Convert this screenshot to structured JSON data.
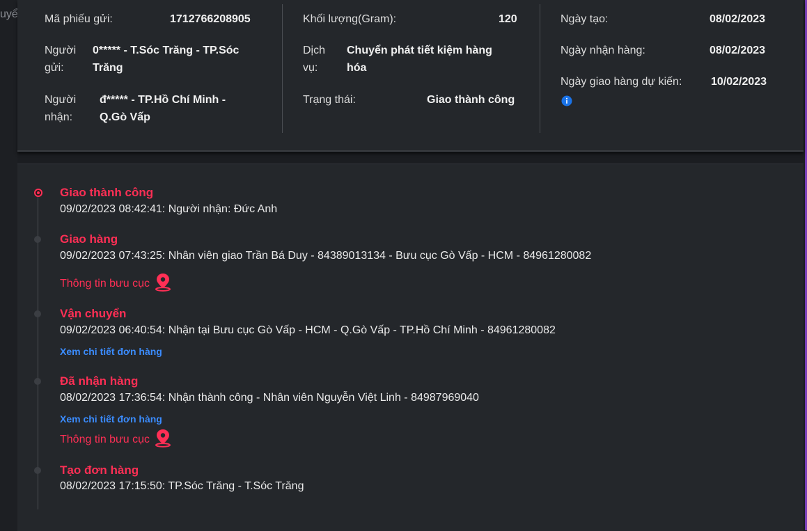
{
  "background": {
    "partial_text": "uyển dụng"
  },
  "info": {
    "col1": {
      "ma_phieu_label": "Mã phiếu gửi:",
      "ma_phieu_value": "1712766208905",
      "nguoi_gui_label_1": "Người",
      "nguoi_gui_label_2": "gửi:",
      "nguoi_gui_value_1": "0***** - T.Sóc Trăng - TP.Sóc",
      "nguoi_gui_value_2": "Trăng",
      "nguoi_nhan_label_1": "Người",
      "nguoi_nhan_label_2": "nhận:",
      "nguoi_nhan_value_1": "đ***** - TP.Hồ Chí Minh -",
      "nguoi_nhan_value_2": "Q.Gò Vấp"
    },
    "col2": {
      "khoi_luong_label": "Khối lượng(Gram):",
      "khoi_luong_value": "120",
      "dich_vu_label_1": "Dịch",
      "dich_vu_label_2": "vụ:",
      "dich_vu_value_1": "Chuyển phát tiết kiệm hàng",
      "dich_vu_value_2": "hóa",
      "trang_thai_label": "Trạng thái:",
      "trang_thai_value": "Giao thành công"
    },
    "col3": {
      "ngay_tao_label": "Ngày tạo:",
      "ngay_tao_value": "08/02/2023",
      "ngay_nhan_label": "Ngày nhận hàng:",
      "ngay_nhan_value": "08/02/2023",
      "ngay_giao_label": "Ngày giao hàng dự kiến:",
      "ngay_giao_value": "10/02/2023",
      "info_icon": "info-icon"
    }
  },
  "timeline": {
    "events": [
      {
        "title": "Giao thành công",
        "desc": "09/02/2023 08:42:41: Người nhận: Đức Anh"
      },
      {
        "title": "Giao hàng",
        "desc": "09/02/2023 07:43:25: Nhân viên giao Trần Bá Duy - 84389013134 - Bưu cục Gò Vấp - HCM - 84961280082",
        "office_link": "Thông tin bưu cục"
      },
      {
        "title": "Vận chuyển",
        "desc": "09/02/2023 06:40:54: Nhận tại Bưu cục Gò Vấp - HCM - Q.Gò Vấp - TP.Hồ Chí Minh - 84961280082",
        "detail_link": "Xem chi tiết đơn hàng"
      },
      {
        "title": "Đã nhận hàng",
        "desc": "08/02/2023 17:36:54: Nhận thành công - Nhân viên Nguyễn Việt Linh - 84987969040",
        "detail_link": "Xem chi tiết đơn hàng",
        "office_link": "Thông tin bưu cục"
      },
      {
        "title": "Tạo đơn hàng",
        "desc": "08/02/2023 17:15:50: TP.Sóc Trăng - T.Sóc Trăng"
      }
    ]
  },
  "colors": {
    "accent_red": "#ff2f55",
    "link_blue": "#3b8cff",
    "card_bg": "#24272b",
    "page_bg": "#1b1d21"
  },
  "icons": [
    "location-pin-icon",
    "info-icon"
  ]
}
